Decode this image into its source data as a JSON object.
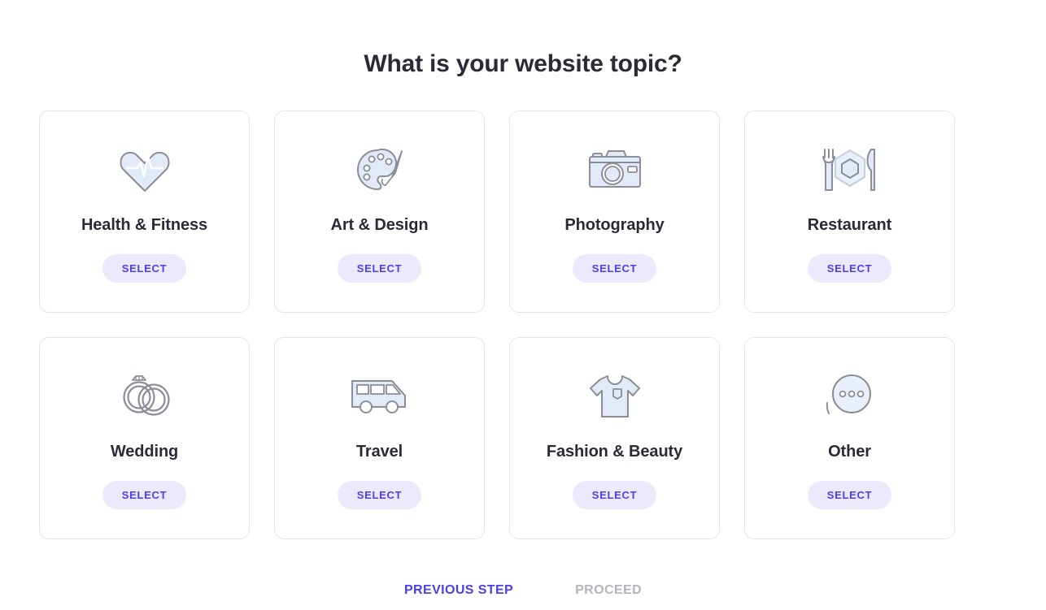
{
  "header": {
    "title": "What is your website topic?"
  },
  "select_label": "SELECT",
  "colors": {
    "title_text": "#2b2b38",
    "accent": "#4b3ff0",
    "button_bg": "#ece9fd",
    "card_border": "#e6e6ea",
    "icon_fill": "#e3eaf7",
    "icon_stroke": "#8b8d99",
    "disabled_text": "#b4b4bb",
    "page_bg": "#ffffff"
  },
  "topics": [
    {
      "id": "health-fitness",
      "label": "Health & Fitness",
      "icon": "heartbeat-icon",
      "select_label": "SELECT"
    },
    {
      "id": "art-design",
      "label": "Art & Design",
      "icon": "palette-icon",
      "select_label": "SELECT"
    },
    {
      "id": "photography",
      "label": "Photography",
      "icon": "camera-icon",
      "select_label": "SELECT"
    },
    {
      "id": "restaurant",
      "label": "Restaurant",
      "icon": "cutlery-icon",
      "select_label": "SELECT"
    },
    {
      "id": "wedding",
      "label": "Wedding",
      "icon": "rings-icon",
      "select_label": "SELECT"
    },
    {
      "id": "travel",
      "label": "Travel",
      "icon": "van-icon",
      "select_label": "SELECT"
    },
    {
      "id": "fashion-beauty",
      "label": "Fashion & Beauty",
      "icon": "tshirt-icon",
      "select_label": "SELECT"
    },
    {
      "id": "other",
      "label": "Other",
      "icon": "ellipsis-circle-icon",
      "select_label": "SELECT"
    }
  ],
  "footer": {
    "previous_label": "PREVIOUS STEP",
    "proceed_label": "PROCEED",
    "proceed_disabled": true
  }
}
